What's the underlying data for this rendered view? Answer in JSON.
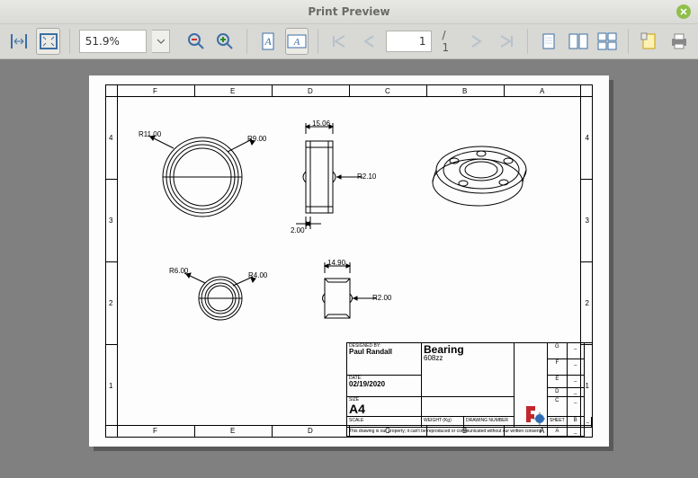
{
  "window": {
    "title": "Print Preview"
  },
  "toolbar": {
    "zoom": "51.9%",
    "page_current": "1",
    "page_total": "/ 1"
  },
  "frame": {
    "cols": [
      "F",
      "E",
      "D",
      "C",
      "B",
      "A"
    ],
    "rows": [
      "4",
      "3",
      "2",
      "1"
    ]
  },
  "dims": {
    "r11": "R11.00",
    "r9": "R9.00",
    "w15": "15.06",
    "r210": "R2.10",
    "h2": "2.00",
    "r6": "R6.00",
    "r4": "R4.00",
    "w149": "14.90",
    "r2": "R2.00"
  },
  "titleblock": {
    "designed_by_lbl": "DESIGNED BY:",
    "designed_by": "Paul Randall",
    "date_lbl": "DATE:",
    "date": "02/19/2020",
    "size_lbl": "SIZE",
    "size": "A4",
    "part_name": "Bearing",
    "part_no": "608zz",
    "scale_lbl": "SCALE",
    "weight_lbl": "WEIGHT (Kg)",
    "drawno_lbl": "DRAWING NUMBER",
    "sheet_lbl": "SHEET",
    "rev_G": "G",
    "rev_F": "F",
    "rev_E": "E",
    "rev_D": "D",
    "rev_C": "C",
    "rev_B": "B",
    "rev_A": "A",
    "rev_dash": "_",
    "disclaimer": "This drawing is our property; it can't be reproduced or communicated without our written consent."
  }
}
